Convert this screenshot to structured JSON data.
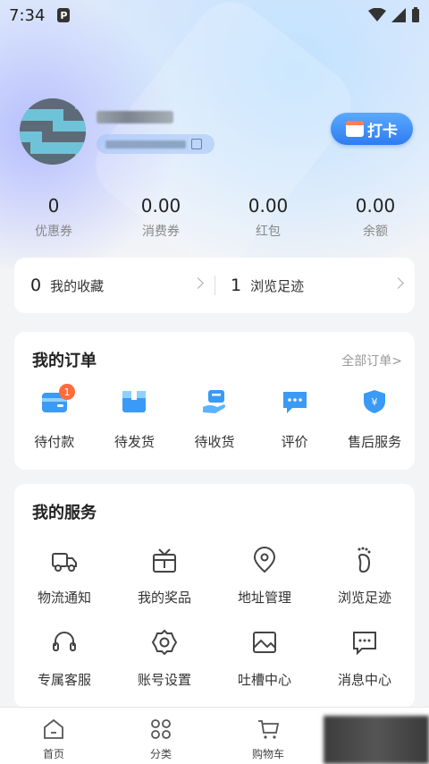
{
  "status_bar": {
    "time": "7:34",
    "app_glyph": "P"
  },
  "profile": {
    "checkin_label": "打卡"
  },
  "stats": [
    {
      "value": "0",
      "label": "优惠券"
    },
    {
      "value": "0.00",
      "label": "消费券"
    },
    {
      "value": "0.00",
      "label": "红包"
    },
    {
      "value": "0.00",
      "label": "余额"
    }
  ],
  "favorites": [
    {
      "count": "0",
      "label": "我的收藏"
    },
    {
      "count": "1",
      "label": "浏览足迹"
    }
  ],
  "orders": {
    "title": "我的订单",
    "all_label": "全部订单",
    "items": [
      {
        "label": "待付款",
        "icon": "wallet-icon",
        "badge": "1"
      },
      {
        "label": "待发货",
        "icon": "box-icon"
      },
      {
        "label": "待收货",
        "icon": "hand-receive-icon"
      },
      {
        "label": "评价",
        "icon": "chat-icon"
      },
      {
        "label": "售后服务",
        "icon": "shield-yen-icon"
      }
    ]
  },
  "services": {
    "title": "我的服务",
    "items": [
      {
        "label": "物流通知",
        "icon": "truck-icon"
      },
      {
        "label": "我的奖品",
        "icon": "gift-icon"
      },
      {
        "label": "地址管理",
        "icon": "location-pin-icon"
      },
      {
        "label": "浏览足迹",
        "icon": "footprint-icon"
      },
      {
        "label": "专属客服",
        "icon": "headset-icon"
      },
      {
        "label": "账号设置",
        "icon": "settings-gear-icon"
      },
      {
        "label": "吐槽中心",
        "icon": "image-frame-icon"
      },
      {
        "label": "消息中心",
        "icon": "message-icon"
      }
    ]
  },
  "tabbar": [
    {
      "label": "首页",
      "icon": "home-icon"
    },
    {
      "label": "分类",
      "icon": "category-icon"
    },
    {
      "label": "购物车",
      "icon": "cart-icon"
    }
  ],
  "colors": {
    "accent": "#2f7cf0",
    "badge": "#ff6b3d"
  }
}
